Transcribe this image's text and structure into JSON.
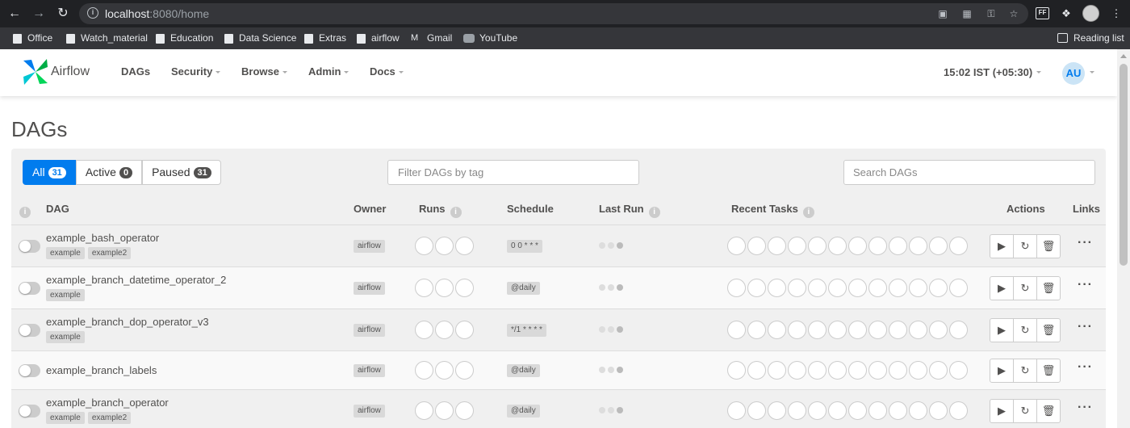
{
  "browser": {
    "url_host": "localhost",
    "url_path": ":8080/home",
    "bookmarks": [
      "Office",
      "Watch_material",
      "Education",
      "Data Science",
      "Extras",
      "airflow",
      "Gmail",
      "YouTube"
    ],
    "reading_list": "Reading list",
    "extension_badge": "FF"
  },
  "navbar": {
    "brand": "Airflow",
    "items": [
      "DAGs",
      "Security",
      "Browse",
      "Admin",
      "Docs"
    ],
    "clock": "15:02 IST (+05:30)",
    "user_initials": "AU"
  },
  "page": {
    "title": "DAGs",
    "filters": [
      {
        "label": "All",
        "count": "31"
      },
      {
        "label": "Active",
        "count": "0"
      },
      {
        "label": "Paused",
        "count": "31"
      }
    ],
    "tag_filter_placeholder": "Filter DAGs by tag",
    "search_placeholder": "Search DAGs"
  },
  "table": {
    "headers": {
      "dag": "DAG",
      "owner": "Owner",
      "runs": "Runs",
      "schedule": "Schedule",
      "last_run": "Last Run",
      "recent_tasks": "Recent Tasks",
      "actions": "Actions",
      "links": "Links"
    },
    "rows": [
      {
        "name": "example_bash_operator",
        "tags": [
          "example",
          "example2"
        ],
        "owner": "airflow",
        "schedule": "0 0 * * *"
      },
      {
        "name": "example_branch_datetime_operator_2",
        "tags": [
          "example"
        ],
        "owner": "airflow",
        "schedule": "@daily"
      },
      {
        "name": "example_branch_dop_operator_v3",
        "tags": [
          "example"
        ],
        "owner": "airflow",
        "schedule": "*/1 * * * *"
      },
      {
        "name": "example_branch_labels",
        "tags": [],
        "owner": "airflow",
        "schedule": "@daily"
      },
      {
        "name": "example_branch_operator",
        "tags": [
          "example",
          "example2"
        ],
        "owner": "airflow",
        "schedule": "@daily"
      }
    ]
  }
}
